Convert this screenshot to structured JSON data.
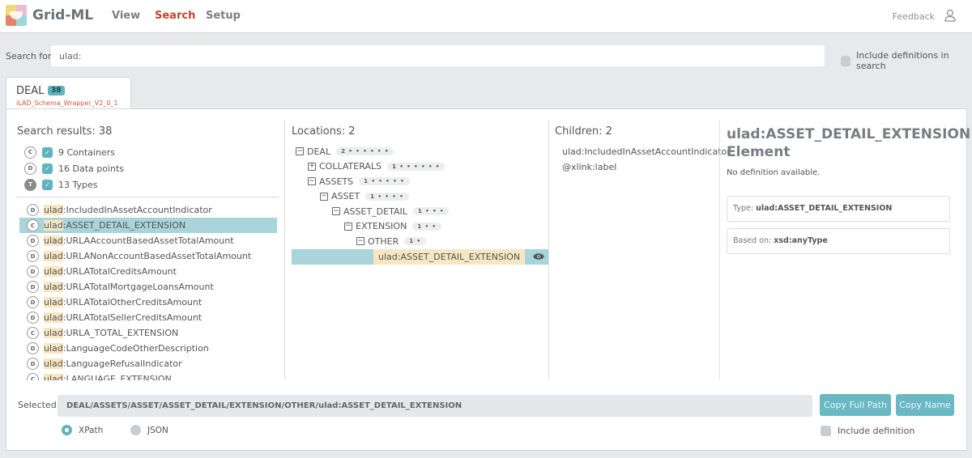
{
  "app": {
    "title": "Grid-ML",
    "nav": [
      {
        "label": "View",
        "active": false
      },
      {
        "label": "Search",
        "active": true
      },
      {
        "label": "Setup",
        "active": false
      }
    ],
    "feedback_label": "Feedback",
    "accent_color": "#5fb3bf",
    "active_nav_color": "#c0462a"
  },
  "search": {
    "label": "Search for:",
    "value": "ulad:",
    "include_definitions_label": "Include definitions in search",
    "include_definitions_checked": false
  },
  "tab": {
    "title": "DEAL",
    "badge": "38",
    "subtitle": "iLAD_Schema_Wrapper_V2_0_1"
  },
  "results": {
    "title": "Search results: 38",
    "filters": [
      {
        "badge": "C",
        "label": "9 Containers",
        "checked": true
      },
      {
        "badge": "D",
        "label": "16 Data points",
        "checked": true
      },
      {
        "badge": "T",
        "label": "13 Types",
        "checked": true
      }
    ],
    "items": [
      {
        "badge": "D",
        "prefix": "ulad",
        "name": ":IncludedInAssetAccountIndicator",
        "selected": false
      },
      {
        "badge": "C",
        "prefix": "ulad",
        "name": ":ASSET_DETAIL_EXTENSION",
        "selected": true
      },
      {
        "badge": "D",
        "prefix": "ulad",
        "name": ":URLAAccountBasedAssetTotalAmount",
        "selected": false
      },
      {
        "badge": "D",
        "prefix": "ulad",
        "name": ":URLANonAccountBasedAssetTotalAmount",
        "selected": false
      },
      {
        "badge": "D",
        "prefix": "ulad",
        "name": ":URLATotalCreditsAmount",
        "selected": false
      },
      {
        "badge": "D",
        "prefix": "ulad",
        "name": ":URLATotalMortgageLoansAmount",
        "selected": false
      },
      {
        "badge": "D",
        "prefix": "ulad",
        "name": ":URLATotalOtherCreditsAmount",
        "selected": false
      },
      {
        "badge": "D",
        "prefix": "ulad",
        "name": ":URLATotalSellerCreditsAmount",
        "selected": false
      },
      {
        "badge": "C",
        "prefix": "ulad",
        "name": ":URLA_TOTAL_EXTENSION",
        "selected": false
      },
      {
        "badge": "D",
        "prefix": "ulad",
        "name": ":LanguageCodeOtherDescription",
        "selected": false
      },
      {
        "badge": "D",
        "prefix": "ulad",
        "name": ":LanguageRefusalIndicator",
        "selected": false
      },
      {
        "badge": "C",
        "prefix": "ulad",
        "name": ":LANGUAGE_EXTENSION",
        "selected": false
      }
    ]
  },
  "locations": {
    "title": "Locations: 2",
    "tree": [
      {
        "label": "DEAL",
        "toggle": "minus",
        "count": "2 • • • • • •",
        "depth": 0
      },
      {
        "label": "COLLATERALS",
        "toggle": "plus",
        "count": "1 • • • • • •",
        "depth": 1
      },
      {
        "label": "ASSETS",
        "toggle": "minus",
        "count": "1 • • • • •",
        "depth": 1
      },
      {
        "label": "ASSET",
        "toggle": "minus",
        "count": "1 • • • •",
        "depth": 2
      },
      {
        "label": "ASSET_DETAIL",
        "toggle": "minus",
        "count": "1 • • •",
        "depth": 3
      },
      {
        "label": "EXTENSION",
        "toggle": "minus",
        "count": "1 • •",
        "depth": 4
      },
      {
        "label": "OTHER",
        "toggle": "minus",
        "count": "1 •",
        "depth": 5
      }
    ],
    "leaf": "ulad:ASSET_DETAIL_EXTENSION"
  },
  "children": {
    "title": "Children: 2",
    "items": [
      "ulad:IncludedInAssetAccountIndicator",
      "@xlink:label"
    ]
  },
  "detail": {
    "title": "ulad:ASSET_DETAIL_EXTENSION Element",
    "description": "No definition available.",
    "type_label": "Type:",
    "type_value": "ulad:ASSET_DETAIL_EXTENSION",
    "based_label": "Based on:",
    "based_value": "xsd:anyType"
  },
  "selected": {
    "label": "Selected:",
    "path": "DEAL/ASSETS/ASSET/ASSET_DETAIL/EXTENSION/OTHER/ulad:ASSET_DETAIL_EXTENSION",
    "copy_full_path_label": "Copy Full Path",
    "copy_name_label": "Copy Name",
    "format_options": [
      {
        "label": "XPath",
        "selected": true
      },
      {
        "label": "JSON",
        "selected": false
      }
    ],
    "include_definition_label": "Include definition",
    "include_definition_checked": false
  }
}
